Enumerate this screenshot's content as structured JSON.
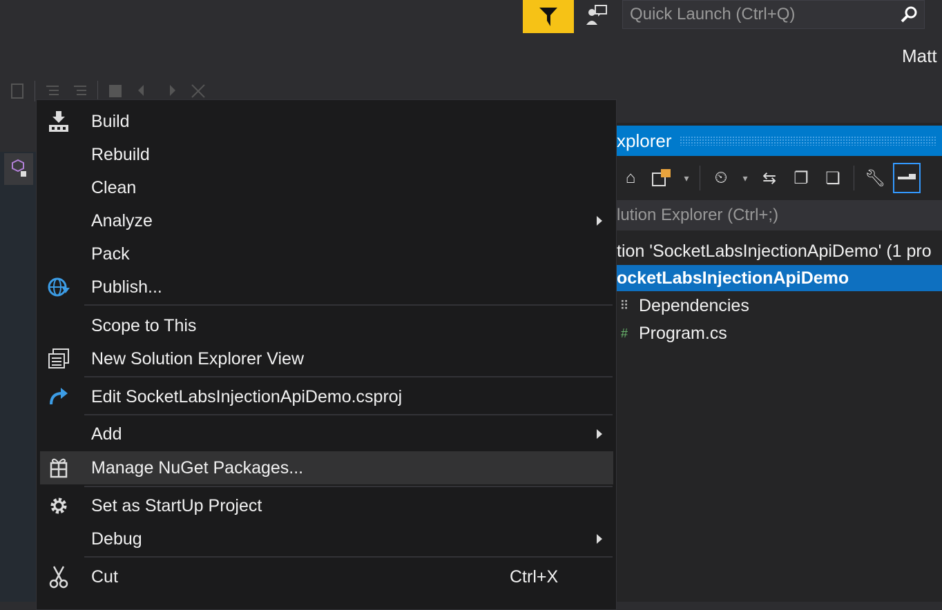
{
  "titlebar": {
    "quick_launch_placeholder": "Quick Launch (Ctrl+Q)",
    "user_name": "Matt"
  },
  "solution_explorer": {
    "title": "xplorer",
    "search_placeholder": "lution Explorer (Ctrl+;)",
    "tree": [
      {
        "label": "tion 'SocketLabsInjectionApiDemo' (1 pro",
        "selected": false
      },
      {
        "label": "ocketLabsInjectionApiDemo",
        "selected": true
      },
      {
        "label": "Dependencies",
        "selected": false
      },
      {
        "label": "Program.cs",
        "selected": false
      }
    ]
  },
  "context_menu": {
    "items": [
      {
        "label": "Build",
        "icon": "build-icon"
      },
      {
        "label": "Rebuild"
      },
      {
        "label": "Clean"
      },
      {
        "label": "Analyze",
        "submenu": true
      },
      {
        "label": "Pack"
      },
      {
        "label": "Publish...",
        "icon": "publish-globe-icon"
      },
      {
        "label": "Scope to This"
      },
      {
        "label": "New Solution Explorer View",
        "icon": "new-view-icon"
      },
      {
        "label": "Edit SocketLabsInjectionApiDemo.csproj",
        "icon": "edit-redo-icon"
      },
      {
        "label": "Add",
        "submenu": true
      },
      {
        "label": "Manage NuGet Packages...",
        "icon": "nuget-icon",
        "highlighted": true
      },
      {
        "label": "Set as StartUp Project",
        "icon": "gear-icon"
      },
      {
        "label": "Debug",
        "submenu": true
      },
      {
        "label": "Cut",
        "icon": "scissors-icon",
        "shortcut": "Ctrl+X"
      }
    ]
  },
  "colors": {
    "accent": "#007acc",
    "feedback": "#f6c216",
    "menu_bg": "#1b1b1c",
    "highlight": "#333334"
  }
}
